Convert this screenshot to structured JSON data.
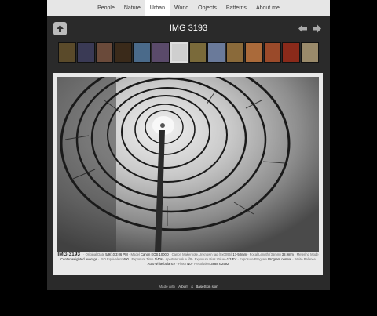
{
  "nav": {
    "items": [
      {
        "label": "People",
        "active": false
      },
      {
        "label": "Nature",
        "active": false
      },
      {
        "label": "Urban",
        "active": true
      },
      {
        "label": "World",
        "active": false
      },
      {
        "label": "Objects",
        "active": false
      },
      {
        "label": "Patterns",
        "active": false
      },
      {
        "label": "About me",
        "active": false
      }
    ]
  },
  "header": {
    "title": "IMG 3193",
    "up_icon": "up-arrow-icon",
    "prev_icon": "left-arrow-icon",
    "next_icon": "right-arrow-icon"
  },
  "thumbnails": {
    "colors": [
      "#5a4a2a",
      "#3a3a55",
      "#6a4a3a",
      "#3a2a1a",
      "#4a6a8a",
      "#5a4a6a",
      "#cfcfcf",
      "#7a6a3a",
      "#6a7a9a",
      "#8a6a3a",
      "#aa6a3a",
      "#9a4a2a",
      "#8a2a1a",
      "#9a8a6a"
    ],
    "current_index": 6
  },
  "photo": {
    "caption_title": "IMG 3193",
    "meta": [
      {
        "label": "Original Date",
        "value": "5/9/10 3:06 PM"
      },
      {
        "label": "Model",
        "value": "Canon EOS 1000D"
      },
      {
        "label": "Canon Makernote.Unknown tag (0x0095)",
        "value": "17-50mm"
      },
      {
        "label": "Focal Length (35mm)",
        "value": "38.9mm"
      },
      {
        "label": "Metering Mode",
        "value": "Center weighted average"
      },
      {
        "label": "ISO Equivalent",
        "value": "400"
      },
      {
        "label": "Exposure Time",
        "value": "1/40s"
      },
      {
        "label": "Aperture Value",
        "value": "f/4"
      },
      {
        "label": "Exposure Bias Value",
        "value": "-1/3 EV"
      },
      {
        "label": "Exposure Program",
        "value": "Program normal"
      },
      {
        "label": "White Balance",
        "value": "Auto white balance"
      },
      {
        "label": "Flash",
        "value": "No"
      },
      {
        "label": "Resolution",
        "value": "3888 x 2592"
      }
    ]
  },
  "footer": {
    "made_with": "Made with",
    "link1": "jAlbum",
    "amp": "&",
    "link2": "BaseSkin skin"
  }
}
